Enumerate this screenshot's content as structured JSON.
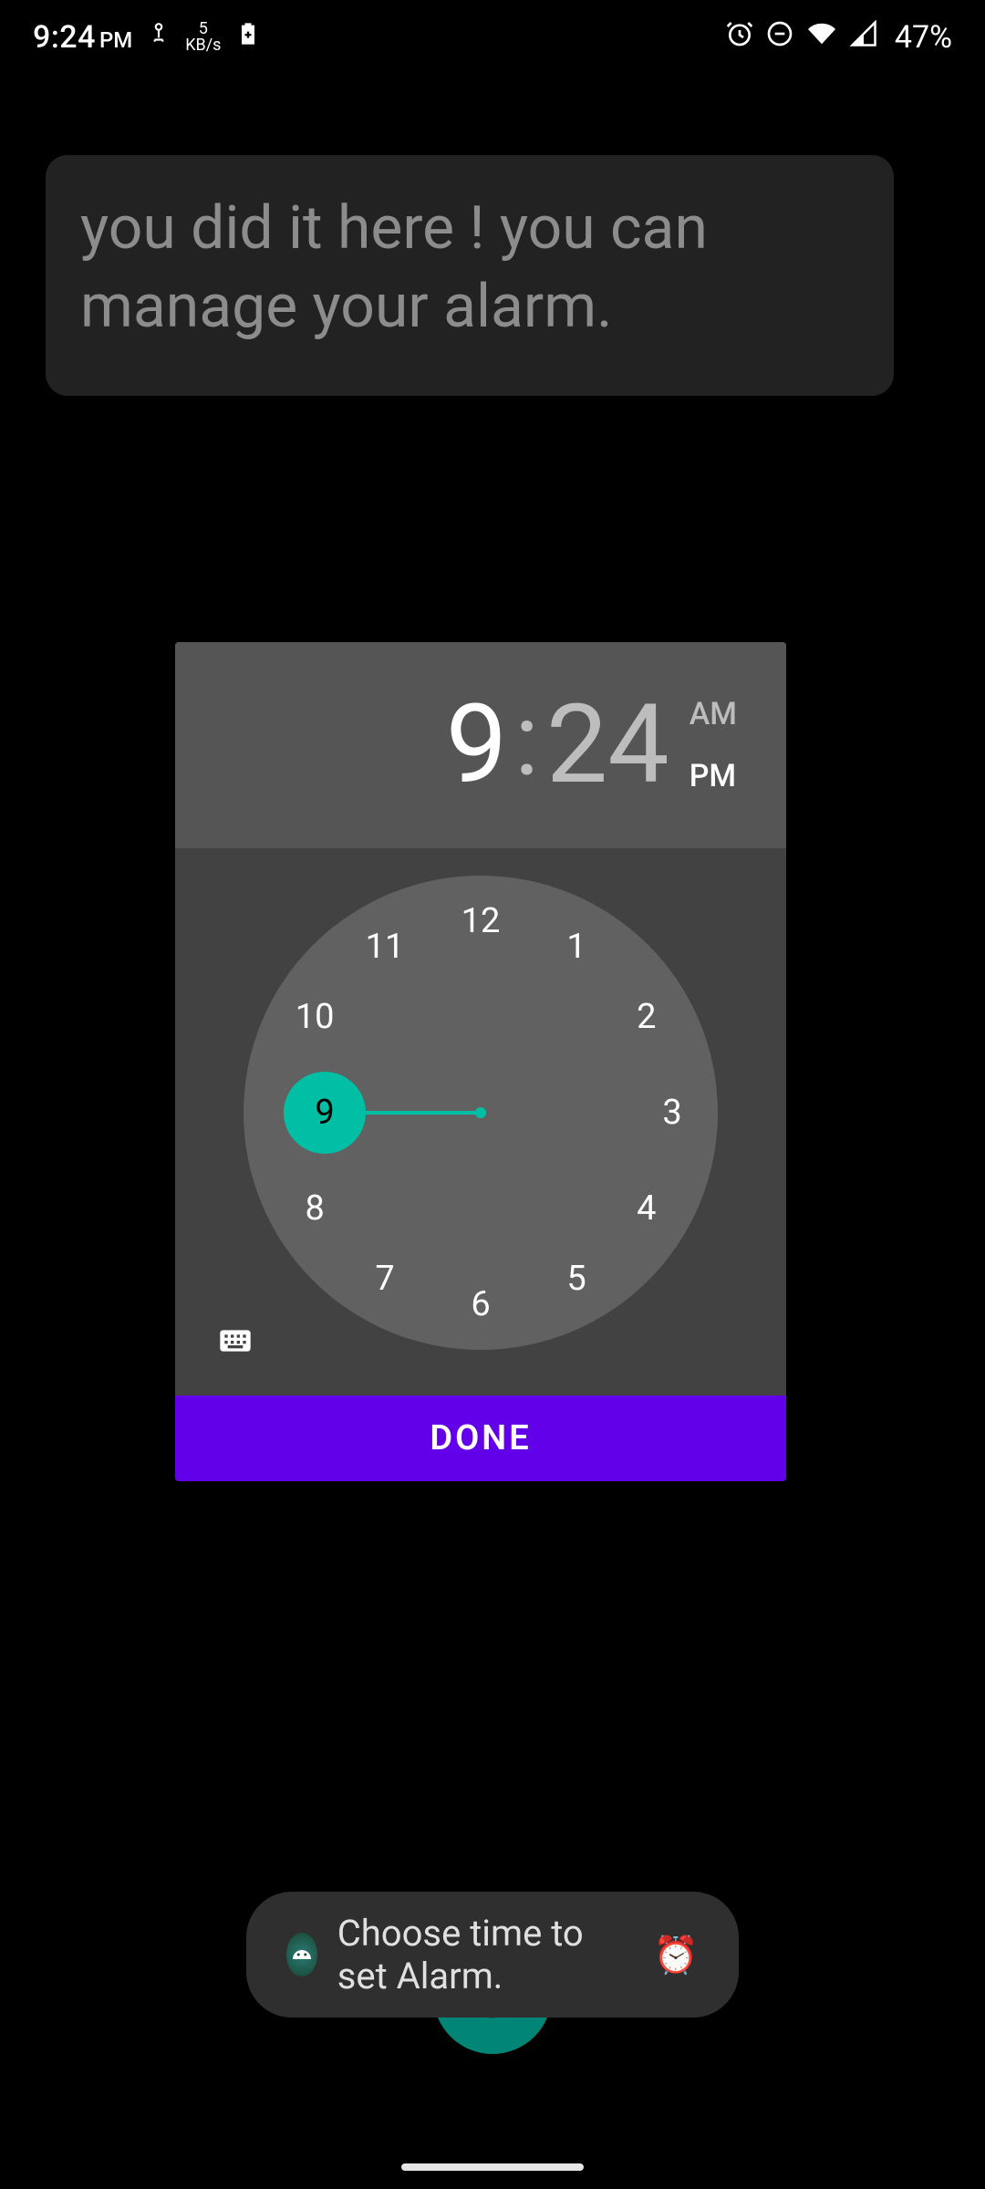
{
  "statusbar": {
    "time": "9:24",
    "time_suffix": "PM",
    "net_speed_value": "5",
    "net_speed_unit": "KB/s",
    "battery_percent": "47%"
  },
  "tooltip": {
    "text": "you did it here ! you can manage your alarm."
  },
  "timepicker": {
    "hour": "9",
    "colon": ":",
    "minute": "24",
    "am_label": "AM",
    "pm_label": "PM",
    "selected_period": "PM",
    "selected_hour_value": 9,
    "hours": [
      "12",
      "1",
      "2",
      "3",
      "4",
      "5",
      "6",
      "7",
      "8",
      "9",
      "10",
      "11"
    ],
    "done_label": "DONE"
  },
  "toast": {
    "text": "Choose time to set Alarm.",
    "emoji": "⏰"
  }
}
